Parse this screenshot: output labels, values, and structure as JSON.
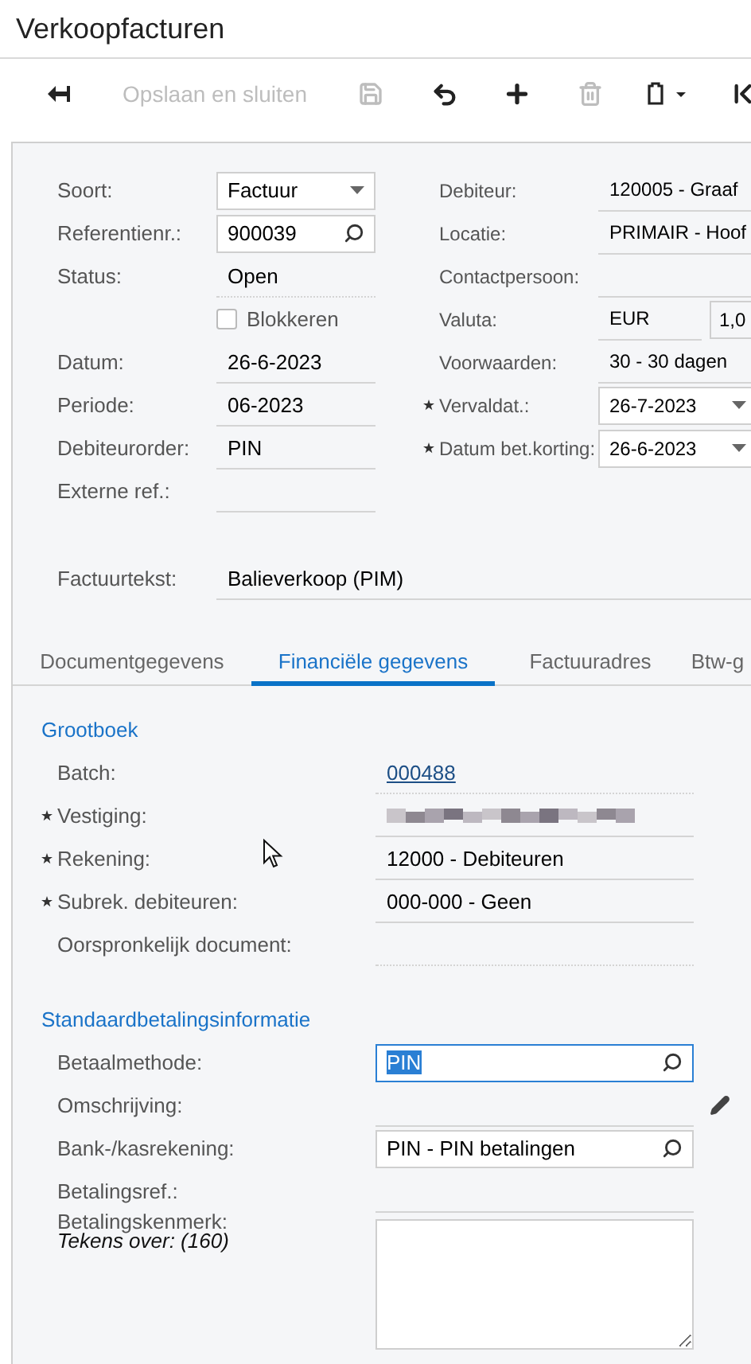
{
  "page_title": "Verkoopfacturen",
  "toolbar": [
    {
      "kind": "back",
      "disabled": false
    },
    {
      "kind": "text",
      "label": "Opslaan en sluiten",
      "disabled": true
    },
    {
      "kind": "save",
      "disabled": true
    },
    {
      "kind": "undo",
      "disabled": false
    },
    {
      "kind": "add",
      "disabled": false
    },
    {
      "kind": "delete",
      "disabled": true
    },
    {
      "kind": "clipboard",
      "disabled": false
    },
    {
      "kind": "first",
      "disabled": false
    }
  ],
  "header_left": [
    {
      "kind": "dropdown",
      "label": "Soort:",
      "value": "Factuur"
    },
    {
      "kind": "lookup",
      "label": "Referentienr.:",
      "value": "900039"
    },
    {
      "kind": "readonly",
      "label": "Status:",
      "value": "Open"
    },
    {
      "kind": "checkbox",
      "label": "Blokkeren",
      "checked": false
    },
    {
      "kind": "text",
      "label": "Datum:",
      "value": "26-6-2023"
    },
    {
      "kind": "text",
      "label": "Periode:",
      "value": "06-2023"
    },
    {
      "kind": "text",
      "label": "Debiteurorder:",
      "value": "PIN"
    },
    {
      "kind": "text",
      "label": "Externe ref.:"
    }
  ],
  "header_right": [
    {
      "kind": "text",
      "label": "Debiteur:",
      "value": "120005 - Graaf",
      "required": false
    },
    {
      "kind": "text",
      "label": "Locatie:",
      "value": "PRIMAIR - Hoof",
      "required": false
    },
    {
      "kind": "text",
      "label": "Contactpersoon:",
      "required": false
    },
    {
      "kind": "currency",
      "label": "Valuta:",
      "value": "EUR",
      "rate": "1,0",
      "required": false
    },
    {
      "kind": "text",
      "label": "Voorwaarden:",
      "value": "30 - 30 dagen",
      "required": false
    },
    {
      "kind": "dropdown",
      "label": "Vervaldat.:",
      "value": "26-7-2023",
      "required": true
    },
    {
      "kind": "dropdown",
      "label": "Datum bet.korting:",
      "value": "26-6-2023",
      "required": true
    }
  ],
  "invoice_text": {
    "label": "Factuurtekst:",
    "value": "Balieverkoop (PIM)"
  },
  "tabs": [
    {
      "label": "Documentgegevens",
      "selected": false
    },
    {
      "label": "Financiële gegevens",
      "selected": true
    },
    {
      "label": "Factuuradres",
      "selected": false
    },
    {
      "label": "Btw-g",
      "selected": false
    }
  ],
  "sections": [
    {
      "title": "Grootboek",
      "fields": [
        {
          "kind": "link",
          "label": "Batch:",
          "value": "000488",
          "required": false
        },
        {
          "kind": "masked",
          "label": "Vestiging:",
          "required": true
        },
        {
          "kind": "text",
          "label": "Rekening:",
          "value": "12000 - Debiteuren",
          "required": true
        },
        {
          "kind": "text",
          "label": "Subrek. debiteuren:",
          "value": "000-000 - Geen",
          "required": true
        },
        {
          "kind": "readonly",
          "label": "Oorspronkelijk document:",
          "required": false
        }
      ]
    },
    {
      "title": "Standaardbetalingsinformatie",
      "fields": [
        {
          "kind": "lookup",
          "label": "Betaalmethode:",
          "value": "PIN",
          "focused": true,
          "required": false
        },
        {
          "kind": "editable",
          "label": "Omschrijving:",
          "required": false
        },
        {
          "kind": "lookup",
          "label": "Bank-/kasrekening:",
          "value": "PIN - PIN betalingen",
          "focused": false,
          "required": false
        },
        {
          "kind": "text",
          "label": "Betalingsref.:",
          "required": false
        },
        {
          "kind": "textarea",
          "label": "Betalingskenmerk:",
          "note": "Tekens over: (160)",
          "required": false
        }
      ]
    }
  ]
}
